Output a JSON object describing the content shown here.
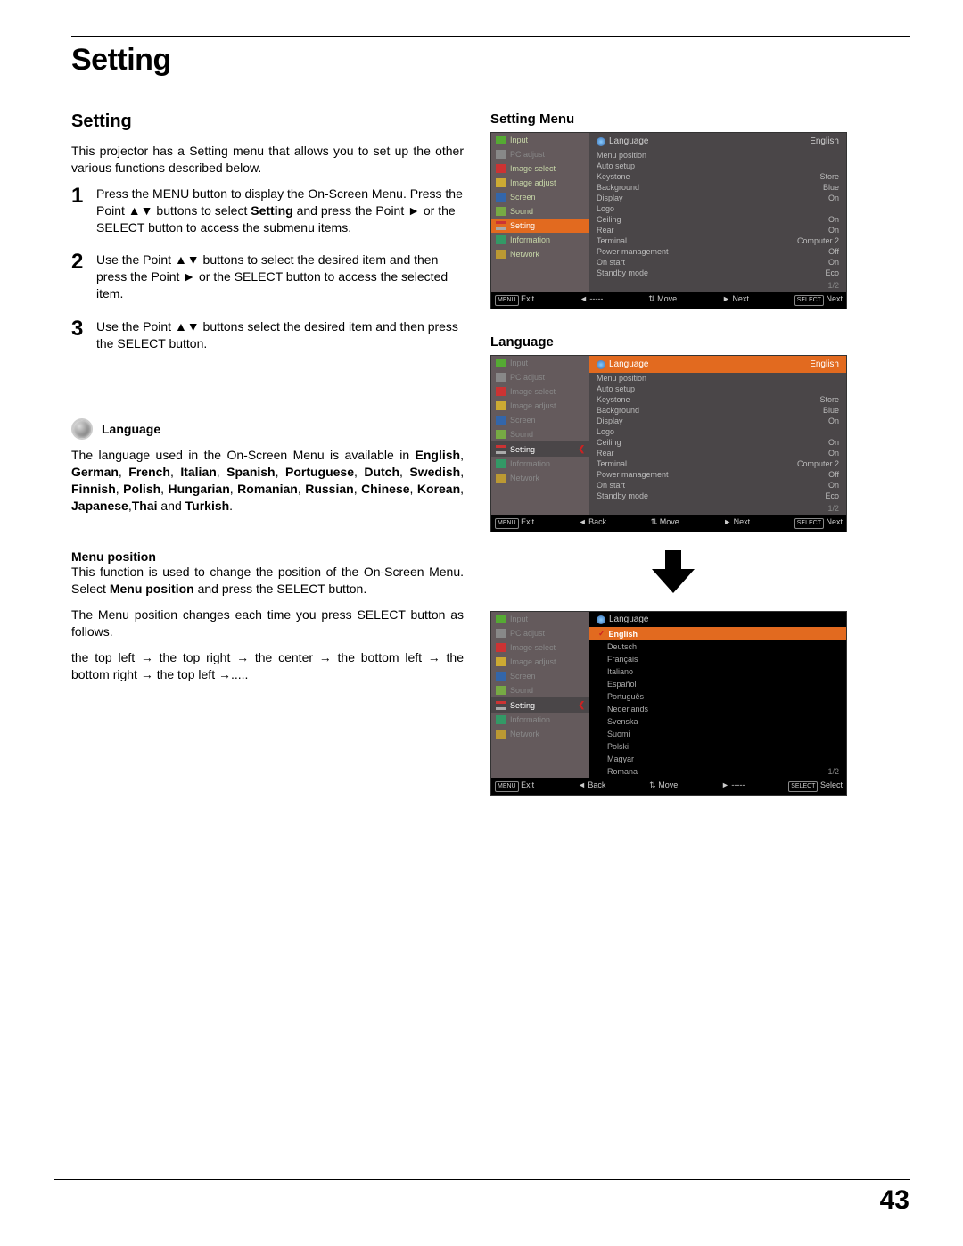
{
  "page": {
    "title": "Setting",
    "section_title": "Setting",
    "number": "43"
  },
  "intro": "This projector has a Setting menu that allows you to set up the other various functions described below.",
  "steps": [
    {
      "num": "1",
      "html": "Press the MENU button to display the On-Screen Menu. Press the Point ▲▼ buttons to select <b>Setting</b> and press the Point ► or the SELECT button to access the submenu items."
    },
    {
      "num": "2",
      "html": "Use the Point ▲▼ buttons to select the desired item and then press the Point ► or the SELECT button to access the selected item."
    },
    {
      "num": "3",
      "html": "Use the Point ▲▼ buttons select the desired item and then press the SELECT button."
    }
  ],
  "language_section": {
    "heading": "Language",
    "body_html": "The language used in the On-Screen Menu is available in <b>English</b>, <b>German</b>, <b>French</b>, <b>Italian</b>, <b>Spanish</b>, <b>Portuguese</b>, <b>Dutch</b>, <b>Swedish</b>, <b>Finnish</b>, <b>Polish</b>, <b>Hungarian</b>, <b>Romanian</b>, <b>Russian</b>, <b>Chinese</b>, <b>Korean</b>, <b>Japanese</b>,<b>Thai</b> and <b>Turkish</b>."
  },
  "menu_position_section": {
    "heading": "Menu position",
    "body1_html": "This function is used to change the position of the On-Screen Menu. Select <b>Menu position</b> and press the SELECT button.",
    "body2": "The Menu position changes each time you press SELECT button as follows.",
    "body3": "the top left  → the top right  → the center → the bottom left → the bottom right → the top left →....."
  },
  "right_headings": {
    "setting_menu": "Setting Menu",
    "language": "Language"
  },
  "main_menu_items": [
    {
      "label": "Input",
      "color": "c-green"
    },
    {
      "label": "PC adjust",
      "color": "c-grey",
      "inactive": true
    },
    {
      "label": "Image select",
      "color": "c-red"
    },
    {
      "label": "Image adjust",
      "color": "c-yellow"
    },
    {
      "label": "Screen",
      "color": "c-blue"
    },
    {
      "label": "Sound",
      "color": "c-sound"
    },
    {
      "label": "Setting",
      "color": "c-tool"
    },
    {
      "label": "Information",
      "color": "c-info"
    },
    {
      "label": "Network",
      "color": "c-net"
    }
  ],
  "setting_values": [
    {
      "k": "Language",
      "v": "English",
      "globe": true
    },
    {
      "k": "Menu position",
      "v": ""
    },
    {
      "k": "Auto setup",
      "v": ""
    },
    {
      "k": "Keystone",
      "v": "Store"
    },
    {
      "k": "Background",
      "v": "Blue"
    },
    {
      "k": "Display",
      "v": "On"
    },
    {
      "k": "Logo",
      "v": ""
    },
    {
      "k": "Ceiling",
      "v": "On"
    },
    {
      "k": "Rear",
      "v": "On"
    },
    {
      "k": "Terminal",
      "v": "Computer 2"
    },
    {
      "k": "Power management",
      "v": "Off"
    },
    {
      "k": "On start",
      "v": "On"
    },
    {
      "k": "Standby mode",
      "v": "Eco"
    }
  ],
  "page_indicator": "1/2",
  "language_options": [
    "English",
    "Deutsch",
    "Français",
    "Italiano",
    "Español",
    "Português",
    "Nederlands",
    "Svenska",
    "Suomi",
    "Polski",
    "Magyar",
    "Romana"
  ],
  "footbars": {
    "s1": {
      "exit": "Exit",
      "back": "-----",
      "move": "Move",
      "next": "Next",
      "select": "Next",
      "exit_tag": "MENU",
      "select_tag": "SELECT"
    },
    "s2": {
      "exit": "Exit",
      "back": "Back",
      "move": "Move",
      "next": "Next",
      "select": "Next",
      "exit_tag": "MENU",
      "select_tag": "SELECT"
    },
    "s3": {
      "exit": "Exit",
      "back": "Back",
      "move": "Move",
      "next": "-----",
      "select": "Select",
      "exit_tag": "MENU",
      "select_tag": "SELECT"
    }
  },
  "glyphs": {
    "up_down": "▲▼",
    "right": "►",
    "left": "◄",
    "updown_sm": "⇅",
    "check": "✓"
  }
}
